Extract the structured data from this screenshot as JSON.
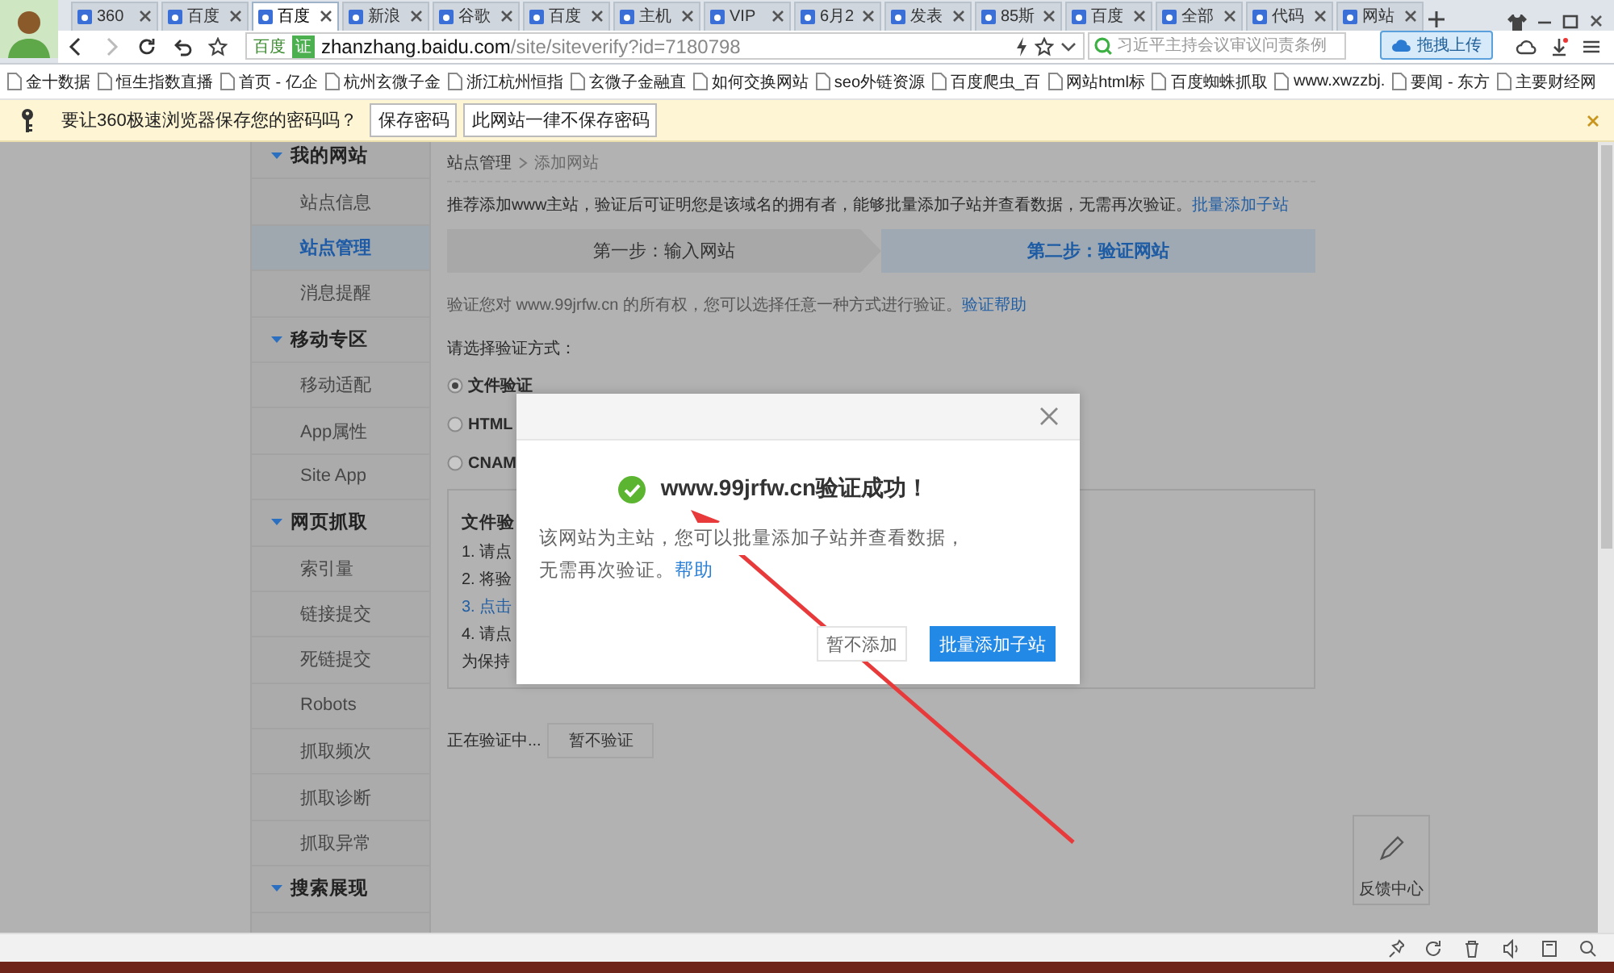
{
  "browser": {
    "tabs": [
      {
        "label": "360",
        "selected": false
      },
      {
        "label": "百度",
        "selected": false
      },
      {
        "label": "百度",
        "selected": true
      },
      {
        "label": "新浪",
        "selected": false
      },
      {
        "label": "谷歌",
        "selected": false
      },
      {
        "label": "百度",
        "selected": false
      },
      {
        "label": "主机",
        "selected": false
      },
      {
        "label": "VIP",
        "selected": false
      },
      {
        "label": "6月2",
        "selected": false
      },
      {
        "label": "发表",
        "selected": false
      },
      {
        "label": "85斯",
        "selected": false
      },
      {
        "label": "百度",
        "selected": false
      },
      {
        "label": "全部",
        "selected": false
      },
      {
        "label": "代码",
        "selected": false
      },
      {
        "label": "网站",
        "selected": false
      }
    ],
    "address": {
      "site_label": "百度",
      "verified_label": "证",
      "domain": "zhanzhang.baidu.com",
      "path": "/site/siteverify?id=7180798"
    },
    "search": {
      "placeholder": "习近平主持会议审议问责条例"
    },
    "upload_tip": "拖拽上传"
  },
  "bookmarks": [
    "金十数据",
    "恒生指数直播",
    "首页 - 亿企",
    "杭州玄微子金",
    "浙江杭州恒指",
    "玄微子金融直",
    "如何交换网站",
    "seo外链资源",
    "百度爬虫_百",
    "网站html标",
    "百度蜘蛛抓取",
    "www.xwzzbj.",
    "要闻 - 东方",
    "主要财经网"
  ],
  "password_prompt": {
    "message": "要让360极速浏览器保存您的密码吗？",
    "buttons": [
      "保存密码",
      "此网站一律不保存密码"
    ]
  },
  "sidebar": {
    "sections": [
      {
        "label": "我的网站",
        "expanded": true,
        "children": [
          {
            "label": "站点信息",
            "selected": false
          },
          {
            "label": "站点管理",
            "selected": true
          },
          {
            "label": "消息提醒",
            "selected": false
          }
        ]
      },
      {
        "label": "移动专区",
        "expanded": true,
        "children": [
          {
            "label": "移动适配",
            "selected": false
          },
          {
            "label": "App属性",
            "selected": false
          },
          {
            "label": "Site App",
            "selected": false
          }
        ]
      },
      {
        "label": "网页抓取",
        "expanded": true,
        "children": [
          {
            "label": "索引量",
            "selected": false
          },
          {
            "label": "链接提交",
            "selected": false
          },
          {
            "label": "死链提交",
            "selected": false
          },
          {
            "label": "Robots",
            "selected": false
          },
          {
            "label": "抓取频次",
            "selected": false
          },
          {
            "label": "抓取诊断",
            "selected": false
          },
          {
            "label": "抓取异常",
            "selected": false
          }
        ]
      },
      {
        "label": "搜索展现",
        "expanded": true
      }
    ]
  },
  "breadcrumb": [
    "站点管理",
    "添加网站"
  ],
  "intro": {
    "text": "推荐添加www主站，验证后可证明您是该域名的拥有者，能够批量添加子站并查看数据，无需再次验证。",
    "link": "批量添加子站"
  },
  "steps": [
    {
      "label": "第一步：输入网站",
      "selected": false
    },
    {
      "label": "第二步：验证网站",
      "selected": true
    }
  ],
  "verify_note": {
    "text": "验证您对 www.99jrfw.cn 的所有权，您可以选择任意一种方式进行验证。",
    "link": "验证帮助"
  },
  "method_prompt": "请选择验证方式：",
  "methods": [
    {
      "label": "文件验证",
      "selected": true
    },
    {
      "label": "HTML",
      "selected": false
    },
    {
      "label": "CNAM",
      "selected": false
    }
  ],
  "file_box": {
    "title": "文件验",
    "lines": [
      {
        "text": "1. 请点",
        "kind": "text"
      },
      {
        "text": "2. 将验",
        "kind": "text"
      },
      {
        "text": "3. 点击",
        "kind": "link"
      },
      {
        "text": "4. 请点",
        "kind": "text"
      },
      {
        "text": "为保持",
        "kind": "text"
      }
    ]
  },
  "verifying": {
    "text": "正在验证中...",
    "button": "暂不验证"
  },
  "feedback": "反馈中心",
  "dialog": {
    "title": "www.99jrfw.cn验证成功！",
    "body_lines": [
      "该网站为主站，您可以批量添加子站并查看数据，",
      "无需再次验证。"
    ],
    "help_link": "帮助",
    "buttons": [
      {
        "label": "暂不添加",
        "kind": "secondary"
      },
      {
        "label": "批量添加子站",
        "kind": "primary"
      }
    ]
  }
}
